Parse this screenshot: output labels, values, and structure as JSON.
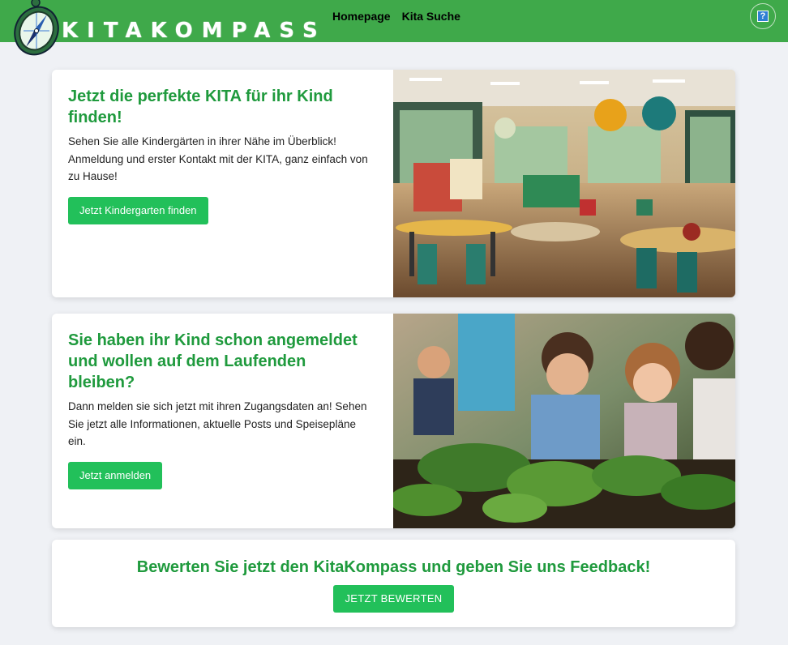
{
  "header": {
    "logo_text": "KITAKOMPASS",
    "nav": [
      "Homepage",
      "Kita Suche"
    ],
    "help_label": "?"
  },
  "card1": {
    "title": "Jetzt die perfekte KITA für ihr Kind finden!",
    "body": "Sehen Sie alle Kindergärten in ihrer Nähe im Überblick! Anmeldung und erster Kontakt mit der KITA, ganz einfach von zu Hause!",
    "button": "Jetzt Kindergarten finden"
  },
  "card2": {
    "title": "Sie haben ihr Kind schon angemeldet und wollen auf dem Laufenden bleiben?",
    "body": "Dann melden sie sich jetzt mit ihren Zugangsdaten an! Sehen Sie jetzt alle Informationen, aktuelle Posts und Speisepläne ein.",
    "button": "Jetzt anmelden"
  },
  "feedback": {
    "title": "Bewerten Sie jetzt den KitaKompass und geben Sie uns Feedback!",
    "button": "JETZT BEWERTEN"
  },
  "colors": {
    "nav_green": "#3fa94a",
    "title_green": "#1f9a3d",
    "button_green": "#22c05a",
    "background": "#eff1f5"
  },
  "icons": [
    "compass-logo-icon",
    "help-icon"
  ]
}
